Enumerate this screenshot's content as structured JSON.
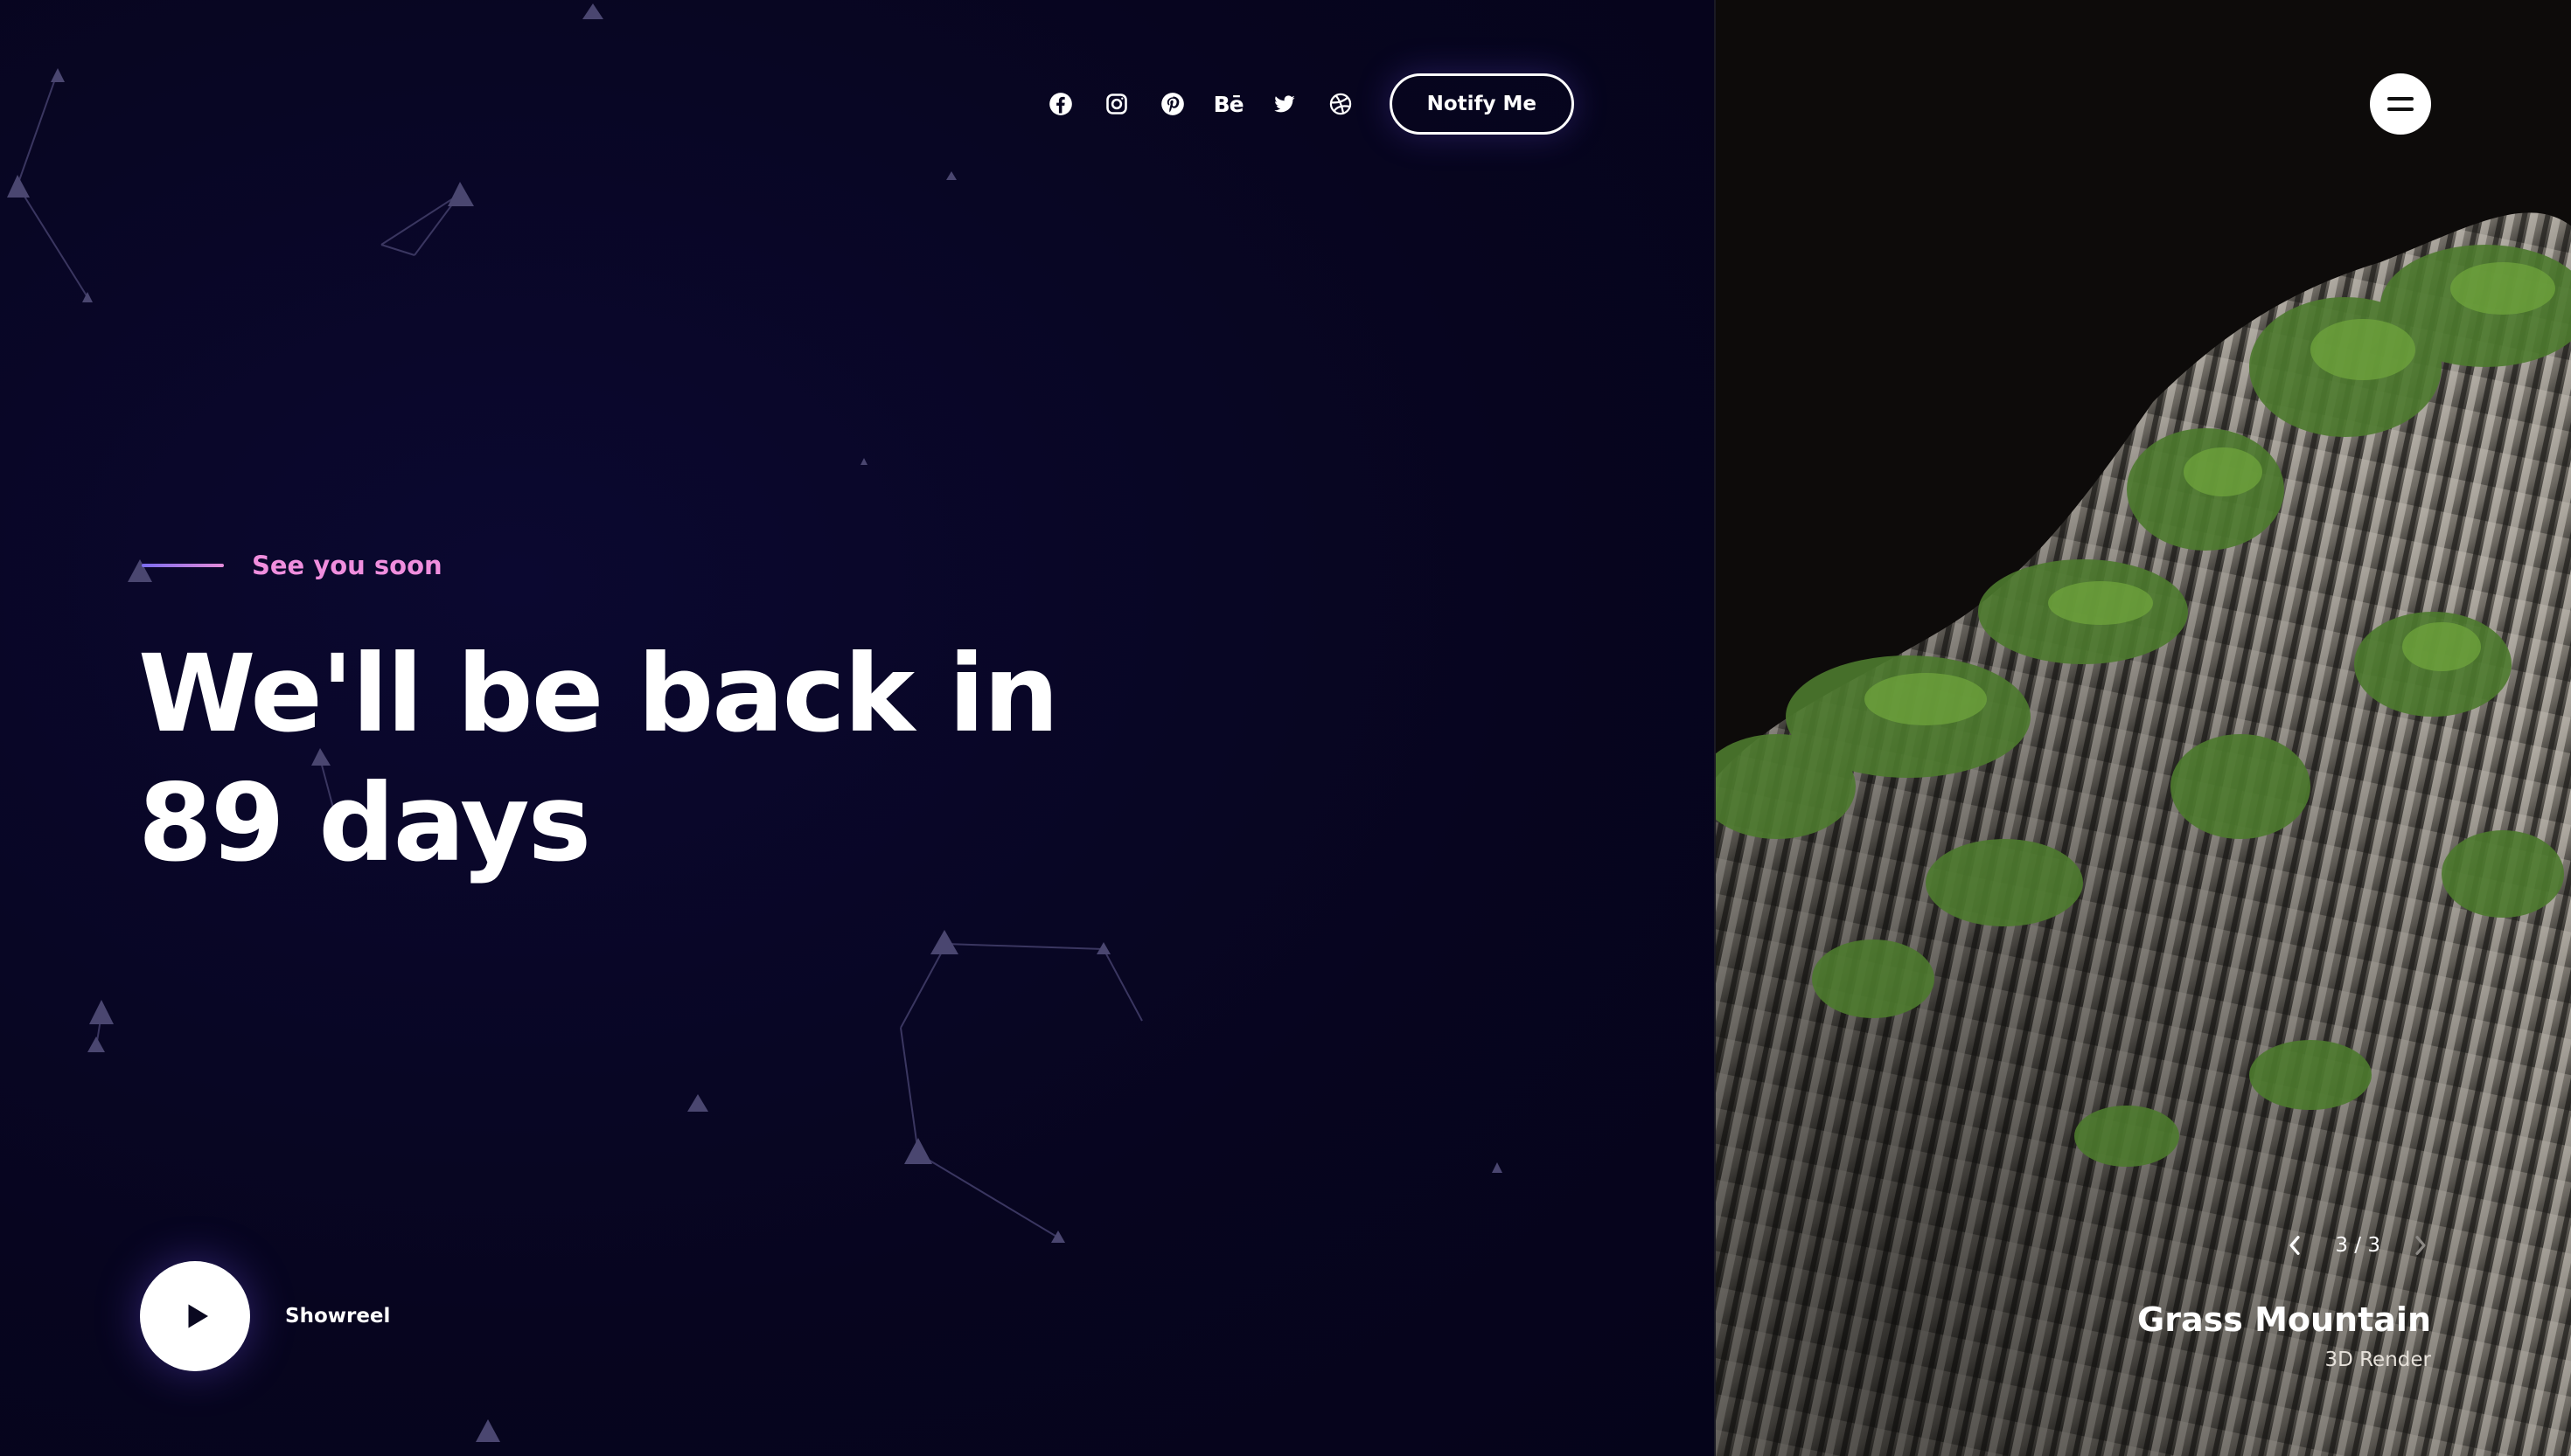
{
  "colors": {
    "background": "#07051f",
    "accent_pink": "#f08ede",
    "accent_purple": "#7b6cf0",
    "text": "#ffffff"
  },
  "header": {
    "social_links": [
      {
        "name": "Facebook",
        "icon": "facebook-icon"
      },
      {
        "name": "Instagram",
        "icon": "instagram-icon"
      },
      {
        "name": "Pinterest",
        "icon": "pinterest-icon"
      },
      {
        "name": "Behance",
        "icon": "behance-icon",
        "glyph": "Bē"
      },
      {
        "name": "Twitter",
        "icon": "twitter-icon"
      },
      {
        "name": "Dribbble",
        "icon": "dribbble-icon"
      }
    ],
    "notify_label": "Notify Me"
  },
  "hero": {
    "eyebrow": "See you soon",
    "headline_line1": "We'll be back in",
    "headline_line2": "89 days"
  },
  "showreel": {
    "label": "Showreel",
    "icon": "play-icon"
  },
  "menu": {
    "icon": "hamburger-menu-icon"
  },
  "slider": {
    "counter": "3 / 3",
    "prev_icon": "chevron-left-icon",
    "next_icon": "chevron-right-icon",
    "title": "Grass Mountain",
    "subtitle": "3D Render"
  }
}
